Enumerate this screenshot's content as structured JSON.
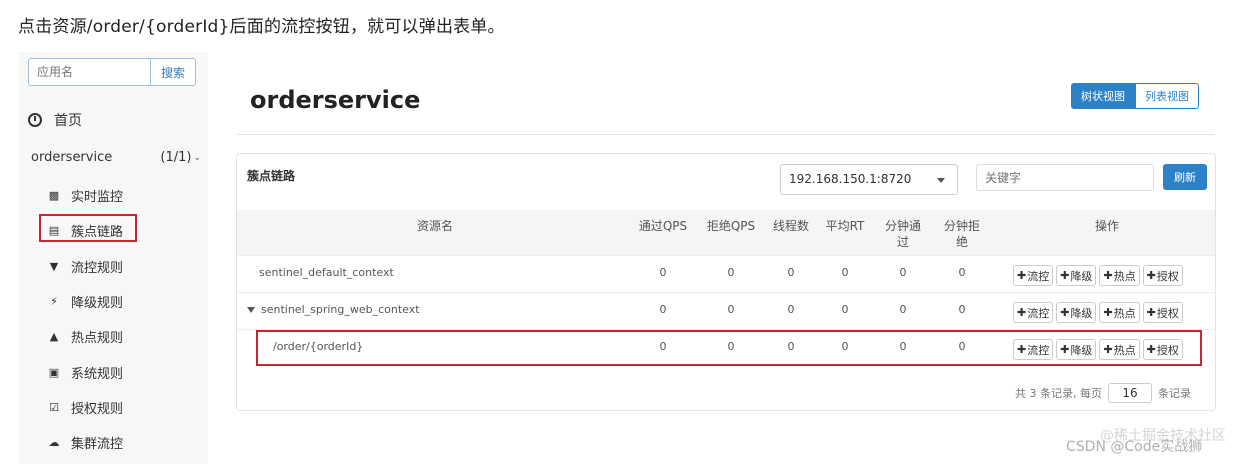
{
  "intro": "点击资源/order/{orderId}后面的流控按钮，就可以弹出表单。",
  "sidebar": {
    "search_placeholder": "应用名",
    "search_button": "搜索",
    "home": "首页",
    "app_name": "orderservice",
    "app_count": "(1/1)",
    "items": [
      {
        "label": "实时监控",
        "icon": "bar-chart-icon"
      },
      {
        "label": "簇点链路",
        "icon": "list-icon"
      },
      {
        "label": "流控规则",
        "icon": "filter-icon"
      },
      {
        "label": "降级规则",
        "icon": "bolt-icon"
      },
      {
        "label": "热点规则",
        "icon": "fire-icon"
      },
      {
        "label": "系统规则",
        "icon": "lock-icon"
      },
      {
        "label": "授权规则",
        "icon": "check-square-icon"
      },
      {
        "label": "集群流控",
        "icon": "cloud-icon"
      }
    ]
  },
  "main": {
    "title": "orderservice",
    "view_tree": "树状视图",
    "view_list": "列表视图",
    "panel_title": "簇点链路",
    "machine": "192.168.150.1:8720",
    "keyword_placeholder": "关键字",
    "refresh": "刷新",
    "columns": {
      "name": "资源名",
      "pass_qps": "通过QPS",
      "block_qps": "拒绝QPS",
      "threads": "线程数",
      "avg_rt": "平均RT",
      "minute_pass_1": "分钟通",
      "minute_pass_2": "过",
      "minute_block_1": "分钟拒",
      "minute_block_2": "绝",
      "ops": "操作"
    },
    "rows": [
      {
        "name": "sentinel_default_context",
        "pass": "0",
        "block": "0",
        "threads": "0",
        "rt": "0",
        "mpass": "0",
        "mblock": "0"
      },
      {
        "name": "sentinel_spring_web_context",
        "pass": "0",
        "block": "0",
        "threads": "0",
        "rt": "0",
        "mpass": "0",
        "mblock": "0"
      },
      {
        "name": "/order/{orderId}",
        "pass": "0",
        "block": "0",
        "threads": "0",
        "rt": "0",
        "mpass": "0",
        "mblock": "0"
      }
    ],
    "ops": {
      "flow": "流控",
      "degrade": "降级",
      "hot": "热点",
      "auth": "授权"
    },
    "pager": {
      "prefix": "共 3 条记录, 每页",
      "size": "16",
      "suffix": "条记录"
    }
  },
  "watermark": {
    "line1": "@稀土掘金技术社区",
    "line2": "CSDN @Code实战狮"
  }
}
